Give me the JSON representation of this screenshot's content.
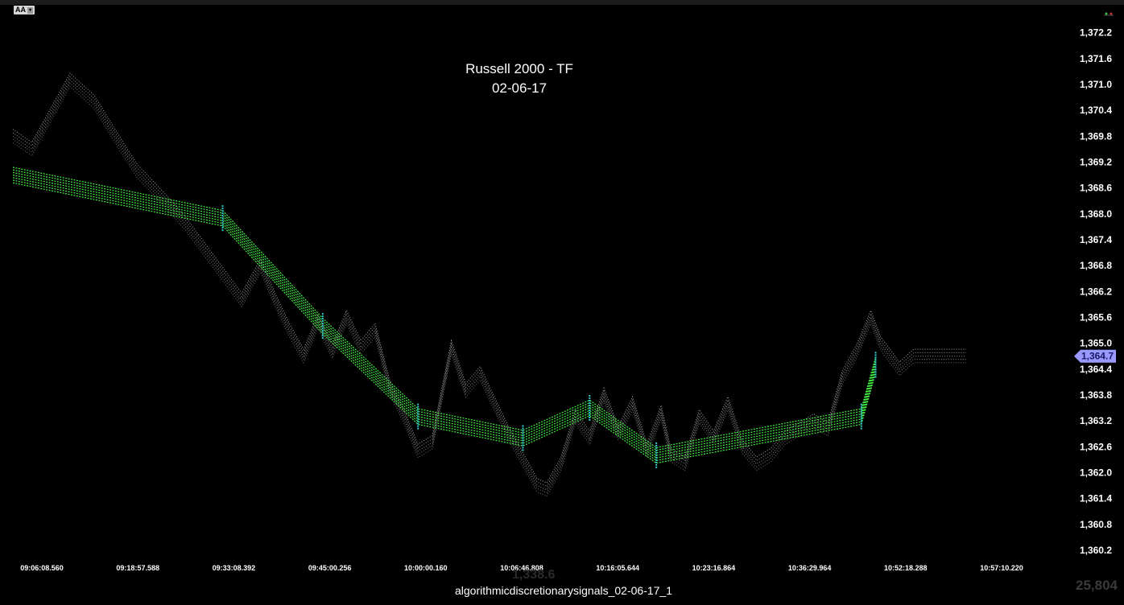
{
  "toolbar": {
    "aa_label": "AA"
  },
  "title": {
    "line1": "Russell 2000 - TF",
    "line2": "02-06-17"
  },
  "footer": {
    "label": "algorithmicdiscretionarysignals_02-06-17_1"
  },
  "ghost": {
    "left_value": "1,338.6",
    "right_value": "25,804"
  },
  "colors": {
    "price": "#bdbdbd",
    "signal": "#44ee44",
    "marker": "#33cccc",
    "last_price_bg": "#9999ff"
  },
  "chart_data": {
    "type": "line",
    "ylim": [
      1359.9,
      1372.4
    ],
    "y_ticks": [
      "1,372.2",
      "1,371.6",
      "1,371.0",
      "1,370.4",
      "1,369.8",
      "1,369.2",
      "1,368.6",
      "1,368.0",
      "1,367.4",
      "1,366.8",
      "1,366.2",
      "1,365.6",
      "1,365.0",
      "1,364.4",
      "1,363.8",
      "1,363.2",
      "1,362.6",
      "1,362.0",
      "1,361.4",
      "1,360.8",
      "1,360.2"
    ],
    "x_ticks": [
      "09:06:08.560",
      "09:18:57.588",
      "09:33:08.392",
      "09:45:00.256",
      "10:00:00.160",
      "10:06:46.808",
      "10:16:05.644",
      "10:23:16.864",
      "10:36:29.964",
      "10:52:18.288",
      "10:57:10.220"
    ],
    "last_price": {
      "value": 1364.7,
      "label": "1,364.7"
    },
    "price_series": {
      "name": "",
      "x": [
        0,
        0.2,
        0.4,
        0.6,
        0.85,
        1.1,
        1.3,
        1.6,
        1.8,
        2.0,
        2.2,
        2.4,
        2.6,
        2.75,
        2.9,
        3.05,
        3.2,
        3.35,
        3.5,
        3.65,
        3.8,
        3.95,
        4.1,
        4.25,
        4.4,
        4.6,
        4.75,
        4.9,
        5.05,
        5.2,
        5.35,
        5.5,
        5.6,
        5.75,
        5.9,
        6.05,
        6.2,
        6.35,
        6.5,
        6.65,
        6.8,
        6.9,
        7.05,
        7.2,
        7.35,
        7.5,
        7.65,
        7.8,
        7.95,
        8.1,
        8.25,
        8.4,
        8.55,
        8.7,
        8.85,
        9.0,
        9.1,
        9.2,
        9.3,
        9.45,
        9.6,
        9.7,
        9.8,
        9.9,
        10.0
      ],
      "values": [
        1369.8,
        1369.5,
        1370.3,
        1371.1,
        1370.6,
        1369.7,
        1369.0,
        1368.3,
        1367.8,
        1367.2,
        1366.6,
        1366.0,
        1366.8,
        1366.0,
        1365.3,
        1364.7,
        1365.5,
        1364.8,
        1365.6,
        1364.9,
        1365.3,
        1364.0,
        1363.3,
        1362.5,
        1362.7,
        1364.9,
        1363.9,
        1364.3,
        1363.6,
        1362.9,
        1362.3,
        1361.7,
        1361.6,
        1362.2,
        1363.3,
        1362.8,
        1363.8,
        1362.9,
        1363.6,
        1362.5,
        1363.4,
        1362.4,
        1362.2,
        1363.3,
        1362.8,
        1363.6,
        1362.6,
        1362.2,
        1362.4,
        1362.8,
        1363.0,
        1363.2,
        1363.0,
        1364.2,
        1364.8,
        1365.6,
        1365.0,
        1364.7,
        1364.4,
        1364.7,
        1364.7,
        1364.7,
        1364.7,
        1364.7,
        1364.7
      ]
    },
    "signal_series": {
      "name": "",
      "x": [
        0,
        2.2,
        3.25,
        4.25,
        5.35,
        6.05,
        6.75,
        8.9,
        9.05
      ],
      "values": [
        1368.9,
        1367.9,
        1365.4,
        1363.3,
        1362.8,
        1363.5,
        1362.4,
        1363.3,
        1364.5
      ]
    }
  }
}
